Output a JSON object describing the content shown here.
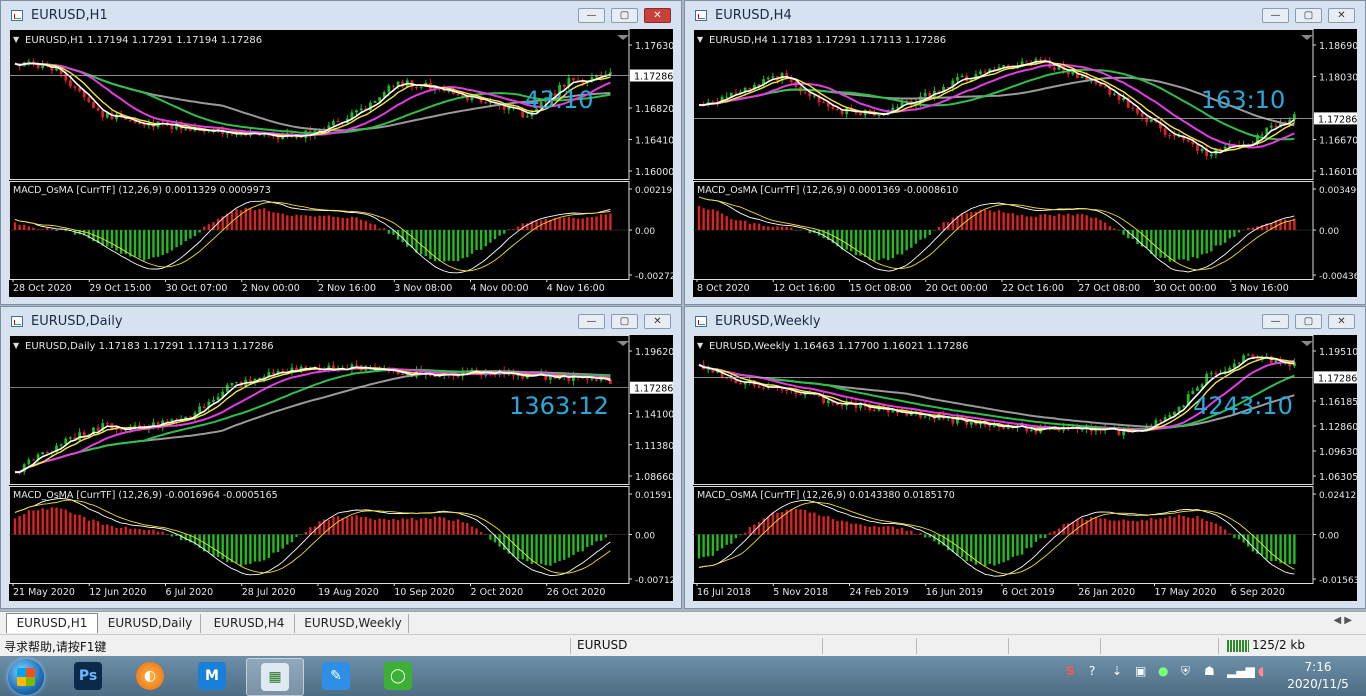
{
  "windows": [
    {
      "title": "EURUSD,H1",
      "header": "EURUSD,H1  1.17194 1.17291 1.17194 1.17286",
      "countdown": "43:10",
      "price_ticks": [
        "1.17630",
        "1.17286",
        "1.16820",
        "1.16410",
        "1.16000"
      ],
      "current_price": "1.17286",
      "macd_label": "MACD_OsMA [CurrTF] (12,26,9) 0.0011329 0.0009973",
      "macd_ticks": [
        "0.002192",
        "0.00",
        "-0.00272"
      ],
      "time_ticks": [
        "28 Oct 2020",
        "29 Oct 15:00",
        "30 Oct 07:00",
        "2 Nov 00:00",
        "2 Nov 16:00",
        "3 Nov 08:00",
        "4 Nov 00:00",
        "4 Nov 16:00"
      ],
      "close_active": true
    },
    {
      "title": "EURUSD,H4",
      "header": "EURUSD,H4  1.17183 1.17291 1.17113 1.17286",
      "countdown": "163:10",
      "price_ticks": [
        "1.18690",
        "1.18030",
        "1.17286",
        "1.16670",
        "1.16010"
      ],
      "current_price": "1.17286",
      "macd_label": "MACD_OsMA [CurrTF] (12,26,9) 0.0001369 -0.0008610",
      "macd_ticks": [
        "0.0034904",
        "0.00",
        "-0.004365"
      ],
      "time_ticks": [
        "8 Oct 2020",
        "12 Oct 16:00",
        "15 Oct 08:00",
        "20 Oct 00:00",
        "22 Oct 16:00",
        "27 Oct 08:00",
        "30 Oct 00:00",
        "3 Nov 16:00"
      ],
      "close_active": false
    },
    {
      "title": "EURUSD,Daily",
      "header": "EURUSD,Daily  1.17183 1.17291 1.17113 1.17286",
      "countdown": "1363:12",
      "price_ticks": [
        "1.19620",
        "1.17286",
        "1.14100",
        "1.11380",
        "1.08660"
      ],
      "current_price": "1.17286",
      "macd_label": "MACD_OsMA [CurrTF] (12,26,9) -0.0016964 -0.0005165",
      "macd_ticks": [
        "0.0159121",
        "0.00",
        "-0.007128"
      ],
      "time_ticks": [
        "21 May 2020",
        "12 Jun 2020",
        "6 Jul 2020",
        "28 Jul 2020",
        "19 Aug 2020",
        "10 Sep 2020",
        "2 Oct 2020",
        "26 Oct 2020"
      ],
      "close_active": false
    },
    {
      "title": "EURUSD,Weekly",
      "header": "EURUSD,Weekly  1.16463 1.17700 1.16021 1.17286",
      "countdown": "4243:10",
      "price_ticks": [
        "1.19510",
        "1.17286",
        "1.16185",
        "1.12860",
        "1.09630",
        "1.06305"
      ],
      "current_price": "1.17286",
      "macd_label": "MACD_OsMA [CurrTF] (12,26,9) 0.0143380 0.0185170",
      "macd_ticks": [
        "0.0241284",
        "0.00",
        "-0.015639"
      ],
      "time_ticks": [
        "16 Jul 2018",
        "5 Nov 2018",
        "24 Feb 2019",
        "16 Jun 2019",
        "6 Oct 2019",
        "26 Jan 2020",
        "17 May 2020",
        "6 Sep 2020"
      ],
      "close_active": false
    }
  ],
  "tabs": [
    "EURUSD,H1",
    "EURUSD,Daily",
    "EURUSD,H4",
    "EURUSD,Weekly"
  ],
  "status": {
    "help": "寻求帮助,请按F1键",
    "symbol": "EURUSD",
    "traffic": "125/2 kb"
  },
  "clock": {
    "time": "7:16",
    "date": "2020/11/5"
  },
  "taskbar_apps": [
    "photoshop-icon",
    "browser-icon",
    "app-m-icon",
    "metatrader-icon",
    "notes-icon",
    "wechat-icon"
  ],
  "colors": {
    "countdown": "#2aa8d8",
    "bull": "#22bb22",
    "bear": "#dd2222",
    "ma_white": "#ffffff",
    "ma_yellow": "#f7e83a",
    "ma_magenta": "#e23ce2",
    "ma_green": "#2fbf4a",
    "ma_gray": "#9a9a9a"
  }
}
